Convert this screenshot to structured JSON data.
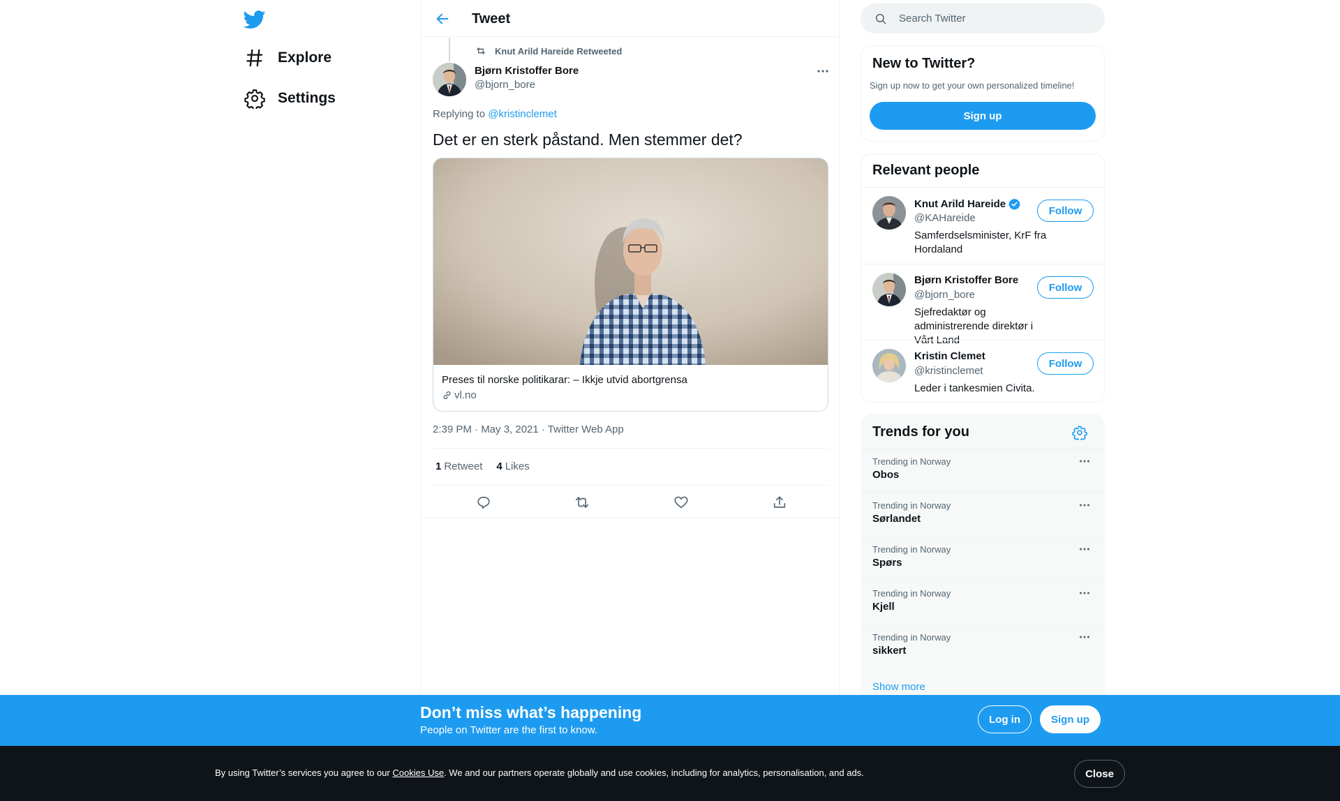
{
  "nav": {
    "explore_label": "Explore",
    "settings_label": "Settings"
  },
  "header": {
    "title": "Tweet"
  },
  "tweet": {
    "retweet_context": "Knut Arild Hareide Retweeted",
    "author_name": "Bjørn Kristoffer Bore",
    "author_handle": "@bjorn_bore",
    "replying_prefix": "Replying to ",
    "replying_to": "@kristinclemet",
    "text": "Det er en sterk påstand. Men stemmer det?",
    "card": {
      "title": "Preses til norske politikarar: – Ikkje utvid abortgrensa",
      "domain": "vl.no"
    },
    "meta": "2:39 PM · May 3, 2021 · Twitter Web App",
    "retweets_count": "1",
    "retweets_label": "Retweet",
    "likes_count": "4",
    "likes_label": "Likes"
  },
  "search": {
    "placeholder": "Search Twitter"
  },
  "new_to_twitter": {
    "heading": "New to Twitter?",
    "subtext": "Sign up now to get your own personalized timeline!",
    "signup_label": "Sign up"
  },
  "relevant_people": {
    "heading": "Relevant people",
    "follow_label": "Follow",
    "people": [
      {
        "name": "Knut Arild Hareide",
        "handle": "@KAHareide",
        "bio": "Samferdselsminister, KrF fra Hordaland",
        "verified": true
      },
      {
        "name": "Bjørn Kristoffer Bore",
        "handle": "@bjorn_bore",
        "bio": "Sjefredaktør og administrerende direktør i Vårt Land",
        "verified": false
      },
      {
        "name": "Kristin Clemet",
        "handle": "@kristinclemet",
        "bio": "Leder i tankesmien Civita.",
        "verified": false
      }
    ]
  },
  "trends": {
    "heading": "Trends for you",
    "show_more_label": "Show more",
    "items": [
      {
        "context": "Trending in Norway",
        "name": "Obos"
      },
      {
        "context": "Trending in Norway",
        "name": "Sørlandet"
      },
      {
        "context": "Trending in Norway",
        "name": "Spørs"
      },
      {
        "context": "Trending in Norway",
        "name": "Kjell"
      },
      {
        "context": "Trending in Norway",
        "name": "sikkert"
      }
    ]
  },
  "banner": {
    "heading": "Don’t miss what’s happening",
    "subtext": "People on Twitter are the first to know.",
    "login_label": "Log in",
    "signup_label": "Sign up"
  },
  "cookie": {
    "text_before": "By using Twitter’s services you agree to our ",
    "link_label": "Cookies Use",
    "text_after": ". We and our partners operate globally and use cookies, including for analytics, personalisation, and ads.",
    "close_label": "Close"
  },
  "colors": {
    "accent": "#1d9bf0",
    "text_primary": "#0f1419",
    "text_secondary": "#536471",
    "cookie_bg": "#0f1419"
  },
  "icons": {
    "logo": "twitter-bird-icon",
    "explore": "hashtag-icon",
    "settings": "gear-icon",
    "back": "arrow-left-icon",
    "search": "search-icon",
    "reply": "reply-icon",
    "retweet": "retweet-icon",
    "like": "heart-icon",
    "share": "share-icon",
    "more": "more-icon",
    "verified": "verified-badge-icon",
    "link": "link-icon"
  }
}
